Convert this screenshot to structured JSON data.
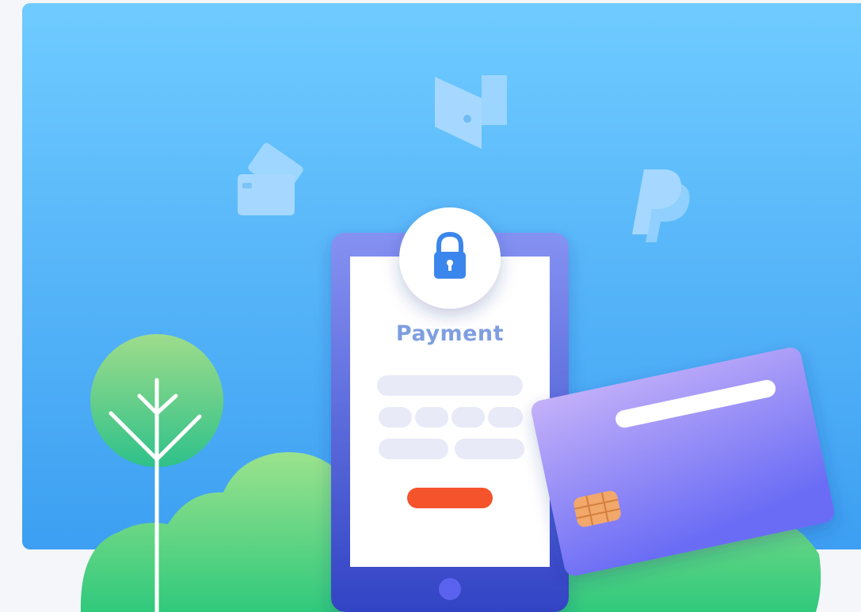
{
  "illustration": {
    "heading": "Payment",
    "colors": {
      "sky_top": "#6fcbff",
      "sky_bottom": "#3d9ff2",
      "tablet_top": "#8592f2",
      "tablet_bottom": "#3243c4",
      "screen": "#ffffff",
      "field": "#e8eaf8",
      "pay_button": "#f4532c",
      "card_top": "#c4b1f9",
      "card_bottom": "#6a6cf5",
      "chip": "#f1a86a",
      "bush_top": "#9be28d",
      "bush_bottom": "#30c97c",
      "tree_top": "#9edc8b",
      "tree_bottom": "#2ec18a",
      "floating_icons": "#a6d8ff"
    },
    "icons": [
      "wallet-icon",
      "credit-cards-icon",
      "paypal-icon",
      "padlock-icon"
    ]
  }
}
